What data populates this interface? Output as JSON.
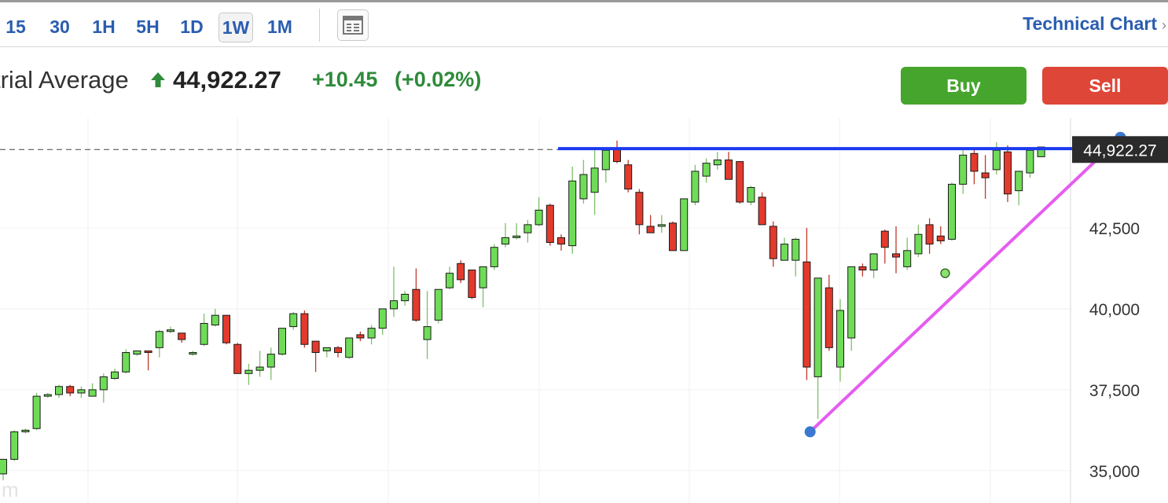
{
  "toolbar": {
    "timeframes": [
      "15",
      "30",
      "1H",
      "5H",
      "1D",
      "1W",
      "1M"
    ],
    "active": "1W",
    "technical_chart_label": "Technical Chart",
    "chevron": "›"
  },
  "quote": {
    "name": "trial Average",
    "price": "44,922.27",
    "change": "+10.45",
    "change_pct": "(+0.02%)",
    "direction_icon": "up-arrow-icon",
    "color_up": "#2e8b3a"
  },
  "actions": {
    "buy_label": "Buy",
    "sell_label": "Sell",
    "buy_color": "#46a52d",
    "sell_color": "#de4638"
  },
  "chart_data": {
    "type": "candlestick",
    "y_ticks": [
      35000,
      37500,
      40000,
      42500
    ],
    "y_tick_labels": [
      "35,000",
      "37,500",
      "40,000",
      "42,500"
    ],
    "ylim": [
      34000,
      45900
    ],
    "price_label": "44,922.27",
    "last_price": 44922.27,
    "watermark": "m",
    "grid": true,
    "colors": {
      "up": "#6fdc58",
      "down": "#e23a2c",
      "trendline": "#e55cf0",
      "resistance": "#1a3af0",
      "handle": "#3b78d0"
    },
    "candles": [
      [
        34900,
        35350,
        34700,
        35350
      ],
      [
        35350,
        36250,
        35300,
        36200
      ],
      [
        36200,
        36300,
        36150,
        36250
      ],
      [
        36300,
        37400,
        36250,
        37300
      ],
      [
        37300,
        37400,
        37250,
        37350
      ],
      [
        37350,
        37650,
        37250,
        37600
      ],
      [
        37600,
        37650,
        37300,
        37400
      ],
      [
        37400,
        37600,
        37250,
        37500
      ],
      [
        37300,
        37700,
        37300,
        37500
      ],
      [
        37500,
        38000,
        37100,
        37900
      ],
      [
        37850,
        38150,
        37800,
        38050
      ],
      [
        38050,
        38750,
        38000,
        38650
      ],
      [
        38600,
        38700,
        38550,
        38700
      ],
      [
        38700,
        38700,
        38100,
        38650
      ],
      [
        38800,
        39350,
        38500,
        39300
      ],
      [
        39300,
        39450,
        39250,
        39350
      ],
      [
        39250,
        39250,
        38950,
        39050
      ],
      [
        38650,
        38700,
        38550,
        38650
      ],
      [
        38900,
        39850,
        38850,
        39550
      ],
      [
        39500,
        40000,
        39450,
        39800
      ],
      [
        39800,
        39800,
        38900,
        38950
      ],
      [
        38900,
        38950,
        38000,
        38000
      ],
      [
        38000,
        38300,
        37650,
        38100
      ],
      [
        38100,
        38700,
        37900,
        38200
      ],
      [
        38200,
        38800,
        37800,
        38600
      ],
      [
        38600,
        39400,
        38550,
        39400
      ],
      [
        39450,
        39900,
        39350,
        39850
      ],
      [
        39850,
        39950,
        38800,
        38900
      ],
      [
        39000,
        39000,
        38050,
        38650
      ],
      [
        38700,
        38800,
        38500,
        38800
      ],
      [
        38800,
        38850,
        38500,
        38650
      ],
      [
        38500,
        39100,
        38450,
        39100
      ],
      [
        39200,
        39300,
        39000,
        39100
      ],
      [
        39100,
        39500,
        38900,
        39400
      ],
      [
        39400,
        40000,
        39200,
        40000
      ],
      [
        40000,
        41300,
        39750,
        40250
      ],
      [
        40250,
        40550,
        40100,
        40450
      ],
      [
        40600,
        41250,
        39600,
        39650
      ],
      [
        39050,
        40550,
        38450,
        39450
      ],
      [
        39650,
        40600,
        39550,
        40600
      ],
      [
        40650,
        41300,
        40600,
        41100
      ],
      [
        41400,
        41500,
        40800,
        40900
      ],
      [
        41200,
        41200,
        40300,
        40350
      ],
      [
        40650,
        41250,
        40050,
        41300
      ],
      [
        41300,
        42000,
        41200,
        41900
      ],
      [
        42000,
        42650,
        41900,
        42200
      ],
      [
        42200,
        42650,
        42150,
        42250
      ],
      [
        42350,
        42750,
        42050,
        42600
      ],
      [
        42600,
        43450,
        42550,
        43050
      ],
      [
        43200,
        43250,
        41950,
        42050
      ],
      [
        42200,
        42300,
        41800,
        42000
      ],
      [
        41950,
        44400,
        41700,
        43950
      ],
      [
        43400,
        44600,
        43250,
        44150
      ],
      [
        43600,
        44950,
        42900,
        44350
      ],
      [
        44300,
        44700,
        43900,
        44900
      ],
      [
        44950,
        45200,
        44500,
        44550
      ],
      [
        44450,
        44600,
        43600,
        43700
      ],
      [
        43600,
        43700,
        42300,
        42600
      ],
      [
        42550,
        42900,
        42450,
        42350
      ],
      [
        42550,
        42900,
        42350,
        42600
      ],
      [
        42650,
        42700,
        41800,
        41800
      ],
      [
        41800,
        43250,
        41800,
        43400
      ],
      [
        43300,
        44450,
        43200,
        44250
      ],
      [
        44100,
        44650,
        43900,
        44500
      ],
      [
        44450,
        44850,
        44300,
        44600
      ],
      [
        44600,
        44850,
        44000,
        44000
      ],
      [
        44550,
        44550,
        43250,
        43300
      ],
      [
        43300,
        43800,
        43200,
        43750
      ],
      [
        43450,
        43600,
        42600,
        42600
      ],
      [
        42550,
        42700,
        41300,
        41550
      ],
      [
        41500,
        42200,
        41500,
        42000
      ],
      [
        41500,
        42200,
        41000,
        42150
      ],
      [
        41450,
        42500,
        37800,
        38200
      ],
      [
        37900,
        40600,
        36600,
        40950
      ],
      [
        40650,
        41050,
        38700,
        38800
      ],
      [
        38200,
        40300,
        37750,
        39950
      ],
      [
        39100,
        41300,
        38700,
        41300
      ],
      [
        41300,
        41400,
        41000,
        41200
      ],
      [
        41200,
        41600,
        40950,
        41700
      ],
      [
        42400,
        42450,
        41400,
        41900
      ],
      [
        41700,
        42550,
        41100,
        41600
      ],
      [
        41300,
        42200,
        41200,
        41800
      ],
      [
        41700,
        42600,
        41600,
        42300
      ],
      [
        42600,
        42800,
        41700,
        42000
      ],
      [
        42250,
        42550,
        42000,
        42100
      ],
      [
        42150,
        43900,
        42100,
        43850
      ],
      [
        43850,
        44950,
        43550,
        44750
      ],
      [
        44800,
        44950,
        43850,
        44250
      ],
      [
        44200,
        44750,
        43400,
        44050
      ],
      [
        44300,
        45150,
        44150,
        44900
      ],
      [
        44850,
        45050,
        43300,
        43550
      ],
      [
        43650,
        44150,
        43200,
        44250
      ],
      [
        44200,
        45000,
        44050,
        44900
      ],
      [
        44700,
        44950,
        44700,
        45000
      ]
    ],
    "annotations": {
      "resistance_level": 44950,
      "trendline_start": {
        "candle": 72.3,
        "value": 36200
      },
      "trendline_mid": {
        "candle": 84.4,
        "value": 41100
      },
      "trendline_end": {
        "candle": 100.1,
        "value": 45300
      }
    }
  }
}
